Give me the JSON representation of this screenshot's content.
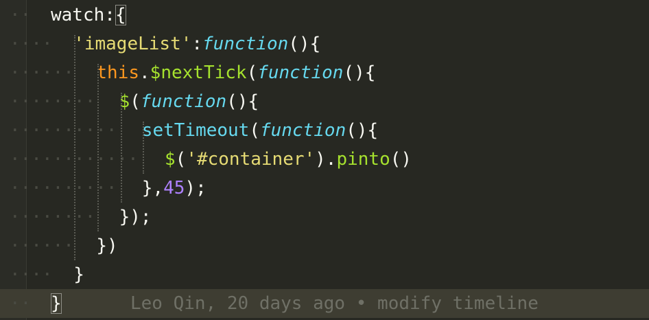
{
  "editor": {
    "lines": [
      {
        "dots": "··",
        "tokens": [
          {
            "t": "watch",
            "c": "kw-plain"
          },
          {
            "t": ":",
            "c": "kw-plain"
          },
          {
            "t": "{",
            "c": "kw-plain"
          }
        ]
      },
      {
        "dots": "····",
        "tokens": [
          {
            "t": "'imageList'",
            "c": "str"
          },
          {
            "t": ":",
            "c": "kw-plain"
          },
          {
            "t": "function",
            "c": "fn-kw"
          },
          {
            "t": "(){",
            "c": "kw-plain"
          }
        ]
      },
      {
        "dots": "······",
        "tokens": [
          {
            "t": "this",
            "c": "this"
          },
          {
            "t": ".",
            "c": "kw-plain"
          },
          {
            "t": "$nextTick",
            "c": "call"
          },
          {
            "t": "(",
            "c": "kw-plain"
          },
          {
            "t": "function",
            "c": "fn-kw"
          },
          {
            "t": "(){",
            "c": "kw-plain"
          }
        ]
      },
      {
        "dots": "········",
        "tokens": [
          {
            "t": "$",
            "c": "call"
          },
          {
            "t": "(",
            "c": "kw-plain"
          },
          {
            "t": "function",
            "c": "fn-kw"
          },
          {
            "t": "(){",
            "c": "kw-plain"
          }
        ]
      },
      {
        "dots": "··········",
        "tokens": [
          {
            "t": "setTimeout",
            "c": "builtin"
          },
          {
            "t": "(",
            "c": "kw-plain"
          },
          {
            "t": "function",
            "c": "fn-kw"
          },
          {
            "t": "(){",
            "c": "kw-plain"
          }
        ]
      },
      {
        "dots": "············",
        "tokens": [
          {
            "t": "$",
            "c": "call"
          },
          {
            "t": "(",
            "c": "kw-plain"
          },
          {
            "t": "'#container'",
            "c": "str"
          },
          {
            "t": ").",
            "c": "kw-plain"
          },
          {
            "t": "pinto",
            "c": "call"
          },
          {
            "t": "()",
            "c": "kw-plain"
          }
        ]
      },
      {
        "dots": "··········",
        "tokens": [
          {
            "t": "},",
            "c": "kw-plain"
          },
          {
            "t": "45",
            "c": "num"
          },
          {
            "t": ");",
            "c": "kw-plain"
          }
        ]
      },
      {
        "dots": "········",
        "tokens": [
          {
            "t": "});",
            "c": "kw-plain"
          }
        ]
      },
      {
        "dots": "······",
        "tokens": [
          {
            "t": "})",
            "c": "kw-plain"
          }
        ]
      },
      {
        "dots": "····",
        "tokens": [
          {
            "t": "}",
            "c": "kw-plain"
          }
        ]
      },
      {
        "dots": "··",
        "tokens": [
          {
            "t": "}",
            "c": "kw-plain"
          }
        ],
        "current": true
      }
    ],
    "blame": {
      "author": "Leo Qin",
      "age": "20 days ago",
      "separator": "•",
      "message": "modify timeline"
    }
  },
  "colors": {
    "background": "#272822",
    "current_line": "#3e3d32",
    "string": "#e6db74",
    "keyword_function": "#66d9ef",
    "this": "#fd971f",
    "call": "#a6e22e",
    "number": "#ae81ff",
    "blame_text": "#6f7066"
  }
}
